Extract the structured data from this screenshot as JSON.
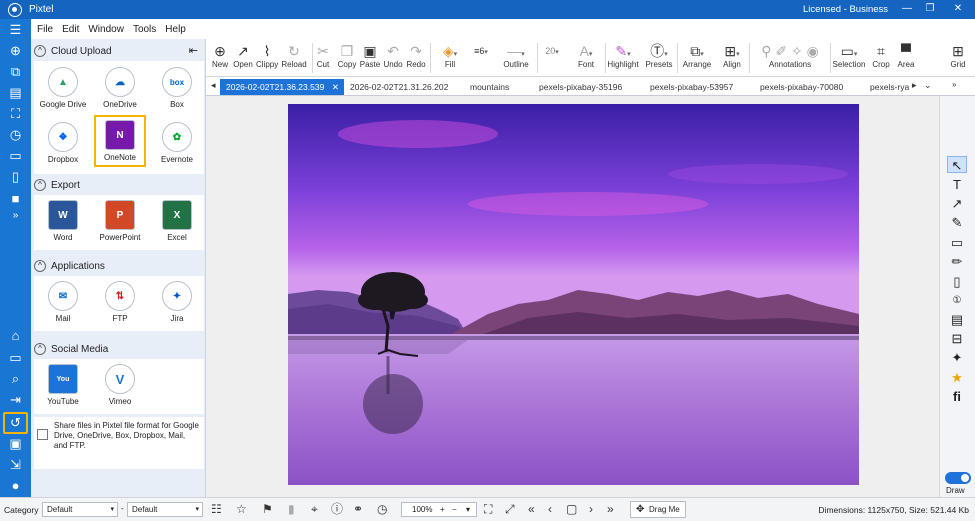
{
  "app": {
    "title": "Pixtel",
    "license": "Licensed - Business",
    "accent": "#1565c0",
    "highlight": "#f5b400"
  },
  "menu": [
    "File",
    "Edit",
    "Window",
    "Tools",
    "Help"
  ],
  "rail_icons": [
    "menu-icon",
    "capture-icon",
    "region-icon",
    "document-icon",
    "scroll-capture-icon",
    "timer-icon",
    "window-icon",
    "page-icon",
    "video-icon",
    "expand-icon",
    "home-icon",
    "folder-icon",
    "search-icon",
    "export-icon",
    "share-icon",
    "print-icon",
    "login-icon",
    "user-icon"
  ],
  "panel": {
    "sections": {
      "cloud": {
        "title": "Cloud Upload",
        "items": [
          "Google Drive",
          "OneDrive",
          "Box",
          "Dropbox",
          "OneNote",
          "Evernote"
        ]
      },
      "export": {
        "title": "Export",
        "items": [
          "Word",
          "PowerPoint",
          "Excel"
        ]
      },
      "apps": {
        "title": "Applications",
        "items": [
          "Mail",
          "FTP",
          "Jira"
        ]
      },
      "social": {
        "title": "Social Media",
        "items": [
          "YouTube",
          "Vimeo"
        ]
      }
    },
    "share_note": "Share files in Pixtel file format for Google Drive, OneDrive, Box, Dropbox, Mail, and FTP.",
    "selected_item": "OneNote"
  },
  "toolbar": {
    "new": "New",
    "open": "Open",
    "clippy": "Clippy",
    "reload": "Reload",
    "cut": "Cut",
    "copy": "Copy",
    "paste": "Paste",
    "undo": "Undo",
    "redo": "Redo",
    "fill": "Fill",
    "outline_width": "6",
    "outline": "Outline",
    "font_size": "20",
    "font": "Font",
    "highlight": "Highlight",
    "presets": "Presets",
    "arrange": "Arrange",
    "align": "Align",
    "annotations": "Annotations",
    "selection": "Selection",
    "crop": "Crop",
    "area": "Area",
    "grid": "Grid"
  },
  "tabs": [
    {
      "label": "2026-02-02T21.36.23.539",
      "active": true
    },
    {
      "label": "2026-02-02T21.31.26.202",
      "active": false
    },
    {
      "label": "mountains",
      "active": false
    },
    {
      "label": "pexels-pixabay-35196",
      "active": false
    },
    {
      "label": "pexels-pixabay-53957",
      "active": false
    },
    {
      "label": "pexels-pixabay-70080",
      "active": false
    },
    {
      "label": "pexels-rya",
      "active": false
    }
  ],
  "right_tools": [
    "pointer-icon",
    "text-icon",
    "arrow-icon",
    "pen-icon",
    "rectangle-icon",
    "marker-icon",
    "blank-page-icon",
    "step-number-icon",
    "image-icon",
    "table-icon",
    "sparkle-icon",
    "star-icon",
    "ligature-icon"
  ],
  "draw": {
    "label": "Draw",
    "on": true
  },
  "status": {
    "category_label": "Category",
    "category_value": "Default",
    "second_value": "Default",
    "zoom": "100%",
    "drag": "Drag Me",
    "dimensions": "Dimensions: 1125x750, Size: 521.44 Kb"
  }
}
